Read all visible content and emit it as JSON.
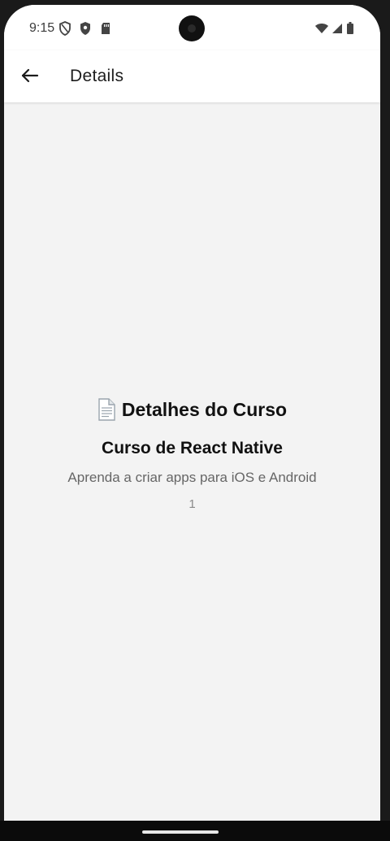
{
  "status_bar": {
    "time": "9:15",
    "icons": [
      "shield-outline-icon",
      "shield-filled-icon",
      "sd-card-icon",
      "wifi-icon",
      "signal-icon",
      "battery-icon"
    ]
  },
  "header": {
    "back_icon": "arrow-left-icon",
    "title": "Details"
  },
  "content": {
    "heading_icon": "document-icon",
    "heading": "Detalhes do Curso",
    "course_title": "Curso de React Native",
    "course_description": "Aprenda a criar apps para iOS e Android",
    "course_id": "1"
  },
  "colors": {
    "background": "#f3f3f3",
    "header_bg": "#ffffff",
    "text_primary": "#111111",
    "text_secondary": "#666666"
  }
}
